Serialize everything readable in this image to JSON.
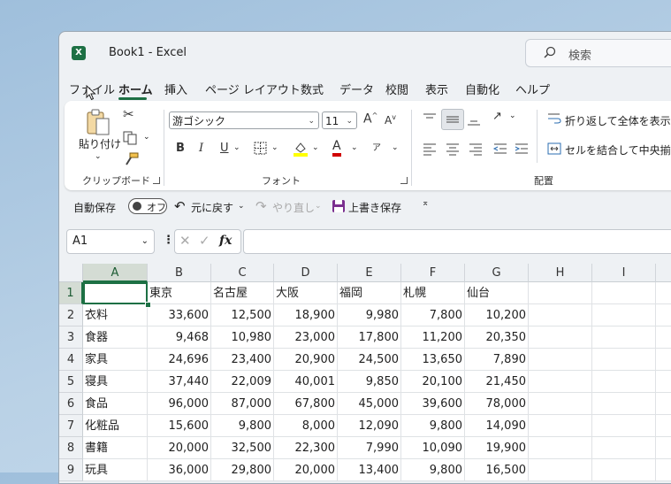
{
  "window": {
    "title": "Book1  -  Excel",
    "app_icon_letter": "X"
  },
  "search": {
    "placeholder": "検索"
  },
  "menu": {
    "tabs": [
      {
        "label": "ファイル"
      },
      {
        "label": "ホーム"
      },
      {
        "label": "挿入"
      },
      {
        "label": "ページ レイアウト"
      },
      {
        "label": "数式"
      },
      {
        "label": "データ"
      },
      {
        "label": "校閲"
      },
      {
        "label": "表示"
      },
      {
        "label": "自動化"
      },
      {
        "label": "ヘルプ"
      }
    ],
    "active_index": 1
  },
  "ribbon": {
    "clipboard": {
      "paste_label": "貼り付け",
      "group_label": "クリップボード"
    },
    "font": {
      "group_label": "フォント",
      "font_name": "游ゴシック",
      "font_size": "11",
      "bold": "B",
      "italic": "I",
      "underline": "U",
      "grow": "A",
      "shrink": "A",
      "font_color": "A",
      "phonetic": "ア",
      "font_color_value": "#d00000",
      "highlight_color_value": "#ffff00"
    },
    "alignment": {
      "group_label": "配置",
      "wrap_text": "折り返して全体を表示する",
      "merge_center": "セルを結合して中央揃え"
    }
  },
  "quick_access": {
    "autosave_label": "自動保存",
    "autosave_state": "オフ",
    "undo_label": "元に戻す",
    "redo_label": "やり直し",
    "save_label": "上書き保存"
  },
  "formula_bar": {
    "name_box": "A1",
    "fx": "fx",
    "value": ""
  },
  "sheet": {
    "columns": [
      "A",
      "B",
      "C",
      "D",
      "E",
      "F",
      "G",
      "H",
      "I"
    ],
    "rows": [
      {
        "num": "1",
        "cells": [
          "",
          "東京",
          "名古屋",
          "大阪",
          "福岡",
          "札幌",
          "仙台"
        ]
      },
      {
        "num": "2",
        "cells": [
          "衣料",
          "33,600",
          "12,500",
          "18,900",
          "9,980",
          "7,800",
          "10,200"
        ]
      },
      {
        "num": "3",
        "cells": [
          "食器",
          "9,468",
          "10,980",
          "23,000",
          "17,800",
          "11,200",
          "20,350"
        ]
      },
      {
        "num": "4",
        "cells": [
          "家具",
          "24,696",
          "23,400",
          "20,900",
          "24,500",
          "13,650",
          "7,890"
        ]
      },
      {
        "num": "5",
        "cells": [
          "寝具",
          "37,440",
          "22,009",
          "40,001",
          "9,850",
          "20,100",
          "21,450"
        ]
      },
      {
        "num": "6",
        "cells": [
          "食品",
          "96,000",
          "87,000",
          "67,800",
          "45,000",
          "39,600",
          "78,000"
        ]
      },
      {
        "num": "7",
        "cells": [
          "化粧品",
          "15,600",
          "9,800",
          "8,000",
          "12,090",
          "9,800",
          "14,090"
        ]
      },
      {
        "num": "8",
        "cells": [
          "書籍",
          "20,000",
          "32,500",
          "22,300",
          "7,990",
          "10,090",
          "19,900"
        ]
      },
      {
        "num": "9",
        "cells": [
          "玩具",
          "36,000",
          "29,800",
          "20,000",
          "13,400",
          "9,800",
          "16,500"
        ]
      }
    ],
    "active_cell": "A1"
  }
}
